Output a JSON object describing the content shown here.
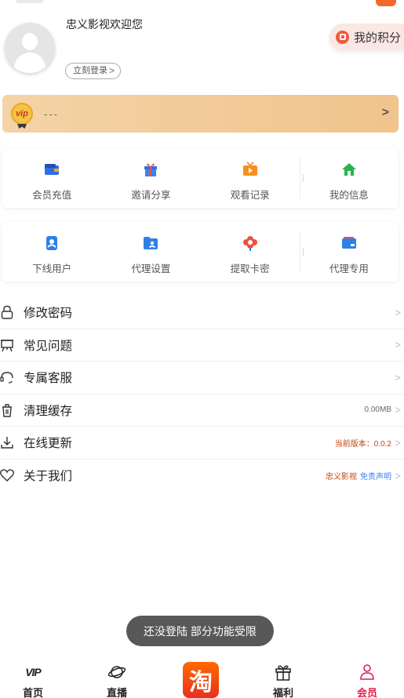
{
  "profile": {
    "welcome": "忠义影视欢迎您",
    "login_button": "立刻登录",
    "points_label": "我的积分"
  },
  "vip": {
    "badge": "vip",
    "status": "---"
  },
  "grid1": [
    {
      "label": "会员充值",
      "icon": "wallet-icon"
    },
    {
      "label": "邀请分享",
      "icon": "gift-icon"
    },
    {
      "label": "观看记录",
      "icon": "tv-icon"
    },
    {
      "label": "我的信息",
      "icon": "home-icon"
    }
  ],
  "grid2": [
    {
      "label": "下线用户",
      "icon": "contacts-icon"
    },
    {
      "label": "代理设置",
      "icon": "folder-user-icon"
    },
    {
      "label": "提取卡密",
      "icon": "flower-icon"
    },
    {
      "label": "代理专用",
      "icon": "card-icon"
    }
  ],
  "menu": [
    {
      "title": "修改密码",
      "icon": "lock-icon",
      "right": ""
    },
    {
      "title": "常见问题",
      "icon": "presentation-icon",
      "right": ""
    },
    {
      "title": "专属客服",
      "icon": "support-icon",
      "right": ""
    },
    {
      "title": "清理缓存",
      "icon": "trash-icon",
      "right": "0.00MB"
    },
    {
      "title": "在线更新",
      "icon": "download-icon",
      "right": "当前版本：0.0.2"
    },
    {
      "title": "关于我们",
      "icon": "heart-icon",
      "right": "忠义影视",
      "right_link": "免责声明"
    }
  ],
  "toast": "还没登陆 部分功能受限",
  "tabbar": {
    "home": "首页",
    "home_icon_text": "VIP",
    "live": "直播",
    "taobao": "淘",
    "welfare": "福利",
    "member": "会员"
  },
  "colors": {
    "accent": "#e11d48",
    "vip_gradient_start": "#f4d3a7",
    "vip_gradient_end": "#f0c48c",
    "toast_bg": "#585858"
  }
}
